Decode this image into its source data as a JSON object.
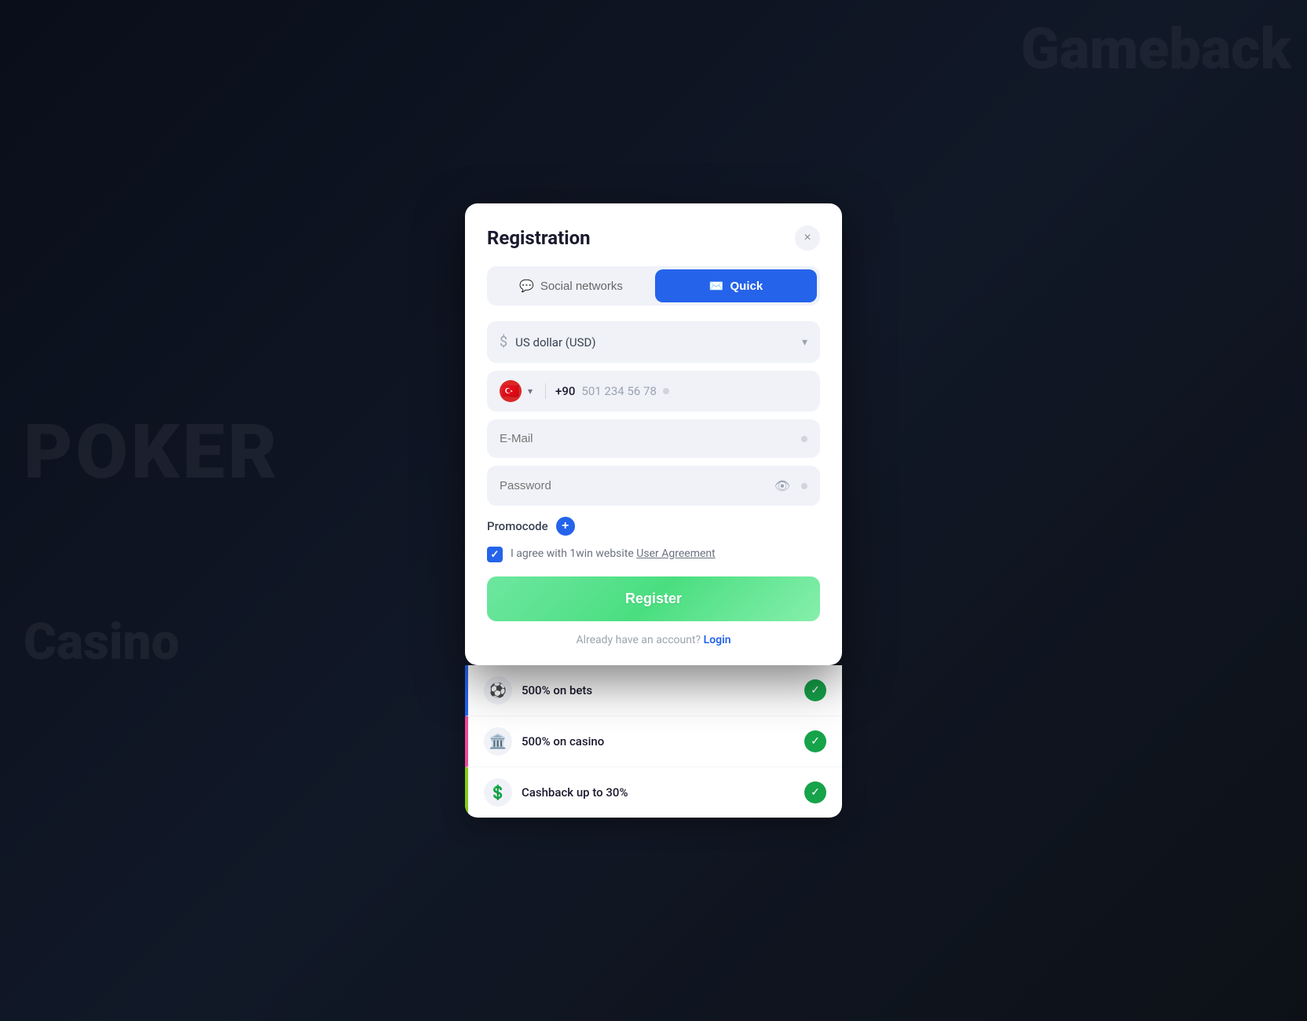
{
  "background": {
    "poker_text": "POKER",
    "casino_text": "Casino",
    "top_right_text": "Gameback"
  },
  "modal": {
    "title": "Registration",
    "close_btn_label": "×",
    "tabs": [
      {
        "id": "social",
        "label": "Social networks",
        "icon": "💬",
        "active": false
      },
      {
        "id": "quick",
        "label": "Quick",
        "icon": "✉️",
        "active": true
      }
    ],
    "currency_field": {
      "icon": "$",
      "value": "US dollar (USD)",
      "placeholder": "US dollar (USD)"
    },
    "phone_field": {
      "country_code": "+90",
      "placeholder": "501 234 56 78",
      "flag": "🇹🇷"
    },
    "email_field": {
      "placeholder": "E-Mail"
    },
    "password_field": {
      "placeholder": "Password"
    },
    "promocode": {
      "label": "Promocode",
      "btn_label": "+"
    },
    "agreement": {
      "text": "I agree with 1win website ",
      "link_text": "User Agreement",
      "checked": true
    },
    "register_btn": "Register",
    "login_row": {
      "text": "Already have an account?",
      "link": "Login"
    }
  },
  "bonus_card": {
    "items": [
      {
        "emoji": "⚽",
        "text": "500% on bets",
        "checked": true
      },
      {
        "emoji": "🏛️",
        "text": "500% on casino",
        "checked": true
      },
      {
        "emoji": "💲",
        "text": "Cashback up to 30%",
        "checked": true
      }
    ]
  }
}
